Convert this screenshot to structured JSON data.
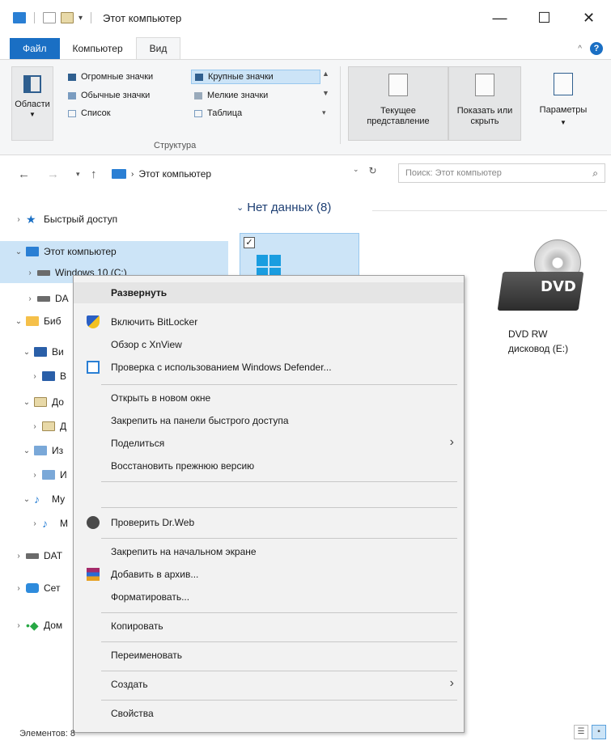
{
  "window": {
    "title": "Этот компьютер"
  },
  "window_controls": [
    "—",
    "☐",
    "✕"
  ],
  "ribbon": {
    "tabs": [
      "Файл",
      "Компьютер",
      "Вид"
    ],
    "areas_label": "Области",
    "layout_items": [
      "Огромные значки",
      "Крупные значки",
      "Обычные значки",
      "Мелкие значки",
      "Список",
      "Таблица"
    ],
    "layout_group_label": "Структура",
    "current_view": "Текущее представление",
    "show_hide": "Показать или скрыть",
    "options": "Параметры"
  },
  "address": {
    "path": "Этот компьютер",
    "search_placeholder": "Поиск: Этот компьютер"
  },
  "nav": {
    "items": [
      "Быстрый доступ",
      "Этот компьютер",
      "Windows 10 (C:)",
      "DA",
      "Биб",
      "Ви",
      "В",
      "До",
      "Д",
      "Из",
      "И",
      "Му",
      "М",
      "DAT",
      "Сет",
      "Дом"
    ]
  },
  "content": {
    "group_header": "Нет данных (8)",
    "dvd_icon_text": "DVD",
    "dvd_label_line1": "DVD RW",
    "dvd_label_line2": "дисковод (E:)"
  },
  "context_menu": {
    "expand": "Развернуть",
    "bitlocker": "Включить BitLocker",
    "xnview": "Обзор с XnView",
    "defender": "Проверка с использованием Windows Defender...",
    "open_new": "Открыть в новом окне",
    "pin_quick": "Закрепить на панели быстрого доступа",
    "share": "Поделиться",
    "restore": "Восстановить прежнюю версию",
    "drweb": "Проверить Dr.Web",
    "pin_start": "Закрепить на начальном экране",
    "archive": "Добавить в архив...",
    "format": "Форматировать...",
    "copy": "Копировать",
    "rename": "Переименовать",
    "create": "Создать",
    "properties": "Свойства"
  },
  "status": {
    "items_count": "Элементов: 8"
  }
}
